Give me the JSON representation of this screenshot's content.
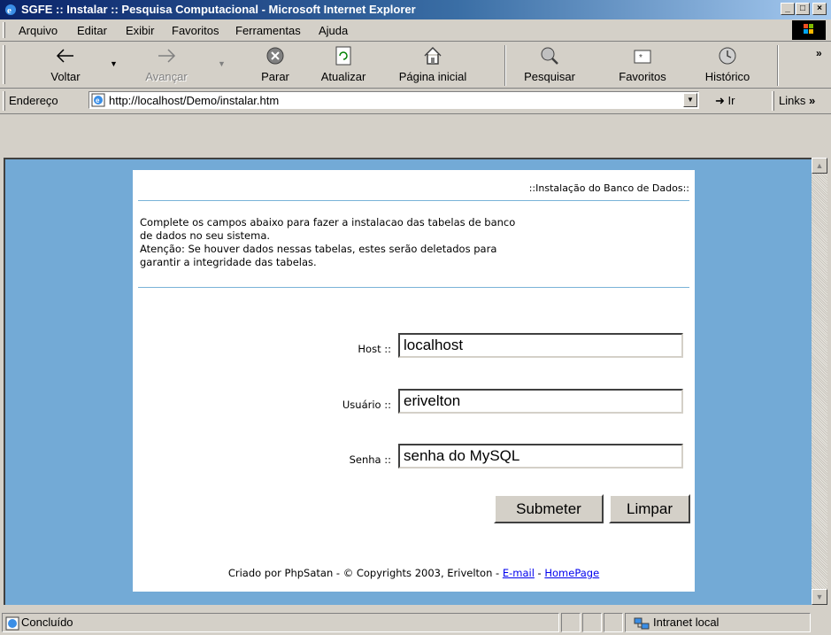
{
  "window": {
    "title": "SGFE :: Instalar :: Pesquisa Computacional - Microsoft Internet Explorer"
  },
  "menu": [
    {
      "label": "Arquivo"
    },
    {
      "label": "Editar"
    },
    {
      "label": "Exibir"
    },
    {
      "label": "Favoritos"
    },
    {
      "label": "Ferramentas"
    },
    {
      "label": "Ajuda"
    }
  ],
  "toolbar": {
    "back": "Voltar",
    "forward": "Avançar",
    "stop": "Parar",
    "refresh": "Atualizar",
    "home": "Página inicial",
    "search": "Pesquisar",
    "favorites": "Favoritos",
    "history": "Histórico"
  },
  "address": {
    "label": "Endereço",
    "url": "http://localhost/Demo/instalar.htm",
    "go": "Ir",
    "links": "Links"
  },
  "page": {
    "heading": "::Instalação do Banco de Dados::",
    "intro_lines": [
      "Complete os campos abaixo para fazer a instalacao das tabelas de banco",
      "de dados no seu sistema.",
      "Atenção: Se houver dados nessas tabelas, estes serão deletados para",
      "garantir a integridade das tabelas."
    ],
    "fields": {
      "host_label": "Host ::",
      "host_value": "localhost",
      "user_label": "Usuário ::",
      "user_value": "erivelton",
      "pass_label": "Senha ::",
      "pass_value": "senha do MySQL"
    },
    "buttons": {
      "submit": "Submeter",
      "reset": "Limpar"
    },
    "footer": {
      "text": "Criado por PhpSatan - © Copyrights 2003, Erivelton - ",
      "sep": " - ",
      "email": "E-mail",
      "homepage": "HomePage"
    }
  },
  "status": {
    "text": "Concluído",
    "zone": "Intranet local"
  }
}
